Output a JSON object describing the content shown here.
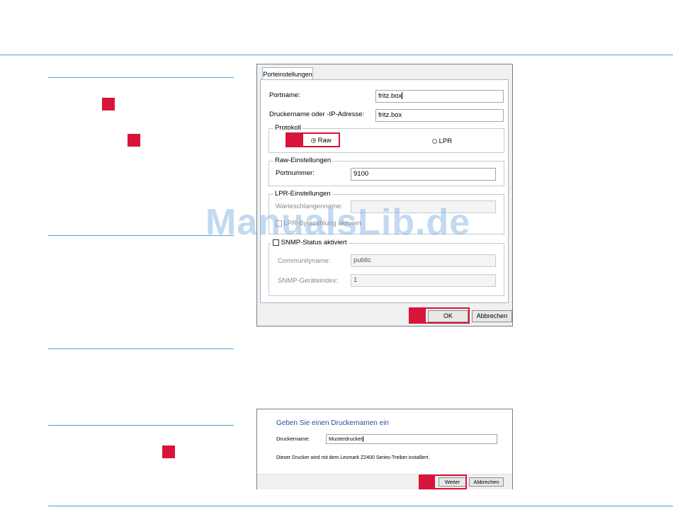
{
  "dialog1": {
    "tab": "Porteinstellungen",
    "portname_label": "Portname:",
    "portname_value": "fritz.box",
    "address_label": "Druckername oder -IP-Adresse:",
    "address_value": "fritz.box",
    "protocol_group": "Protokoll",
    "raw_label": "Raw",
    "lpr_label": "LPR",
    "raw_group": "Raw-Einstellungen",
    "portnumber_label": "Portnummer:",
    "portnumber_value": "9100",
    "lpr_group": "LPR-Einstellungen",
    "queue_label": "Warteschlangenname:",
    "lpr_bytecount_label": "LPR-Bytezählung aktiviert",
    "snmp_label": "SNMP-Status aktiviert",
    "community_label": "Communityname:",
    "community_value": "public",
    "device_index_label": "SNMP-Geräteindex:",
    "device_index_value": "1",
    "ok_label": "OK",
    "cancel_label": "Abbrechen"
  },
  "dialog2": {
    "heading": "Geben Sie einen Druckernamen ein",
    "printer_name_label": "Druckername:",
    "printer_name_value": "Musterdrucker",
    "info_text": "Dieser Drucker wird mit dem Lexmark Z2400 Series-Treiber installiert.",
    "next_label": "Weiter",
    "cancel_label": "Abbrechen"
  },
  "watermark": "ManualsLib.de",
  "colors": {
    "accent_line": "#4aa3cf",
    "highlight": "#d9143a",
    "heading_blue": "#1f4e9c"
  }
}
